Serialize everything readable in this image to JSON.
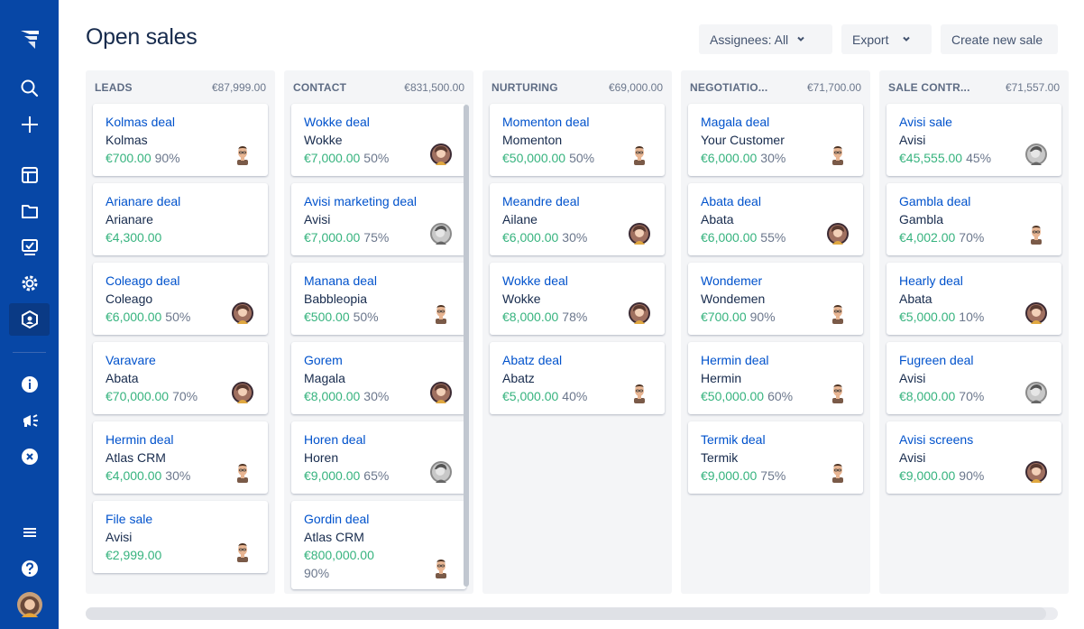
{
  "header": {
    "title": "Open sales",
    "assignees_label": "Assignees: All",
    "export_label": "Export",
    "create_label": "Create new sale"
  },
  "sidebar": {
    "items": [
      {
        "name": "logo-icon"
      },
      {
        "name": "search-icon"
      },
      {
        "name": "plus-icon"
      },
      {
        "name": "board-icon"
      },
      {
        "name": "folder-icon"
      },
      {
        "name": "report-icon"
      },
      {
        "name": "gear-icon"
      },
      {
        "name": "crm-icon"
      },
      {
        "name": "info-icon"
      },
      {
        "name": "megaphone-icon"
      },
      {
        "name": "close-circle-icon"
      },
      {
        "name": "menu-icon"
      },
      {
        "name": "help-icon"
      },
      {
        "name": "profile-avatar"
      }
    ]
  },
  "colors": {
    "sidebar": "#0747a6",
    "link": "#0052cc",
    "amount": "#36b37e",
    "muted": "#6b778c"
  },
  "columns": [
    {
      "name": "LEADS",
      "total": "€87,999.00",
      "cards": [
        {
          "title": "Kolmas deal",
          "company": "Kolmas",
          "amount": "€700.00",
          "prob": "90%",
          "avatar": "man"
        },
        {
          "title": "Arianare deal",
          "company": "Arianare",
          "amount": "€4,300.00",
          "prob": "",
          "avatar": ""
        },
        {
          "title": "Coleago deal",
          "company": "Coleago",
          "amount": "€6,000.00",
          "prob": "50%",
          "avatar": "woman"
        },
        {
          "title": "Varavare",
          "company": "Abata",
          "amount": "€70,000.00",
          "prob": "70%",
          "avatar": "woman"
        },
        {
          "title": "Hermin deal",
          "company": "Atlas CRM",
          "amount": "€4,000.00",
          "prob": "30%",
          "avatar": "man"
        },
        {
          "title": "File sale",
          "company": "Avisi",
          "amount": "€2,999.00",
          "prob": "",
          "avatar": "man"
        }
      ]
    },
    {
      "name": "CONTACT",
      "total": "€831,500.00",
      "cards": [
        {
          "title": "Wokke deal",
          "company": "Wokke",
          "amount": "€7,000.00",
          "prob": "50%",
          "avatar": "woman"
        },
        {
          "title": "Avisi marketing deal",
          "company": "Avisi",
          "amount": "€7,000.00",
          "prob": "75%",
          "avatar": "gray"
        },
        {
          "title": "Manana deal",
          "company": "Babbleopia",
          "amount": "€500.00",
          "prob": "50%",
          "avatar": "man"
        },
        {
          "title": "Gorem",
          "company": "Magala",
          "amount": "€8,000.00",
          "prob": "30%",
          "avatar": "woman"
        },
        {
          "title": "Horen deal",
          "company": "Horen",
          "amount": "€9,000.00",
          "prob": "65%",
          "avatar": "gray"
        },
        {
          "title": "Gordin deal",
          "company": "Atlas CRM",
          "amount": "€800,000.00",
          "prob": "90%",
          "avatar": "man",
          "tall": true
        }
      ]
    },
    {
      "name": "NURTURING",
      "total": "€69,000.00",
      "cards": [
        {
          "title": "Momenton deal",
          "company": "Momenton",
          "amount": "€50,000.00",
          "prob": "50%",
          "avatar": "man"
        },
        {
          "title": "Meandre deal",
          "company": "Ailane",
          "amount": "€6,000.00",
          "prob": "30%",
          "avatar": "woman"
        },
        {
          "title": "Wokke deal",
          "company": "Wokke",
          "amount": "€8,000.00",
          "prob": "78%",
          "avatar": "woman"
        },
        {
          "title": "Abatz deal",
          "company": "Abatz",
          "amount": "€5,000.00",
          "prob": "40%",
          "avatar": "man"
        }
      ]
    },
    {
      "name": "NEGOTIATIO...",
      "total": "€71,700.00",
      "cards": [
        {
          "title": "Magala deal",
          "company": "Your Customer",
          "amount": "€6,000.00",
          "prob": "30%",
          "avatar": "man"
        },
        {
          "title": "Abata deal",
          "company": "Abata",
          "amount": "€6,000.00",
          "prob": "55%",
          "avatar": "woman"
        },
        {
          "title": "Wondemer",
          "company": "Wondemen",
          "amount": "€700.00",
          "prob": "90%",
          "avatar": "man"
        },
        {
          "title": "Hermin deal",
          "company": "Hermin",
          "amount": "€50,000.00",
          "prob": "60%",
          "avatar": "man"
        },
        {
          "title": "Termik deal",
          "company": "Termik",
          "amount": "€9,000.00",
          "prob": "75%",
          "avatar": "man"
        }
      ]
    },
    {
      "name": "SALE CONTR...",
      "total": "€71,557.00",
      "cards": [
        {
          "title": "Avisi sale",
          "company": "Avisi",
          "amount": "€45,555.00",
          "prob": "45%",
          "avatar": "gray"
        },
        {
          "title": "Gambla deal",
          "company": "Gambla",
          "amount": "€4,002.00",
          "prob": "70%",
          "avatar": "man"
        },
        {
          "title": "Hearly deal",
          "company": "Abata",
          "amount": "€5,000.00",
          "prob": "10%",
          "avatar": "woman"
        },
        {
          "title": "Fugreen deal",
          "company": "Avisi",
          "amount": "€8,000.00",
          "prob": "70%",
          "avatar": "gray"
        },
        {
          "title": "Avisi screens",
          "company": "Avisi",
          "amount": "€9,000.00",
          "prob": "90%",
          "avatar": "woman"
        }
      ]
    }
  ]
}
